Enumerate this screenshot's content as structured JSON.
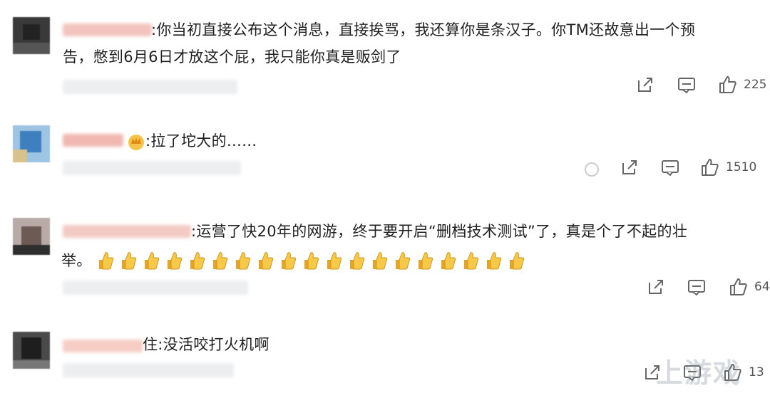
{
  "comments": [
    {
      "text_line1": ":你当初直接公布这个消息，直接挨骂，我还算你是条汉子。你TM还故意出一个预",
      "text_line2": "告，憋到6月6日才放这个屁，我只能你真是贩剑了",
      "likes": "225"
    },
    {
      "text_line1": ":拉了坨大的……",
      "likes": "1510"
    },
    {
      "text_line1": ":运营了快20年的网游，终于要开启“删档技术测试”了，真是个了不起的壮",
      "text_line2": "举。",
      "thumb_emoji_count": 19,
      "likes": "64"
    },
    {
      "text_line1": "住:没活咬打火机啊",
      "likes": "13"
    }
  ],
  "icons": {
    "share": "share-icon",
    "comment": "comment-icon",
    "like": "thumbs-up-icon",
    "emoji": "thumbs-up-emoji",
    "crown": "crown-icon"
  },
  "watermark": "上游戏"
}
